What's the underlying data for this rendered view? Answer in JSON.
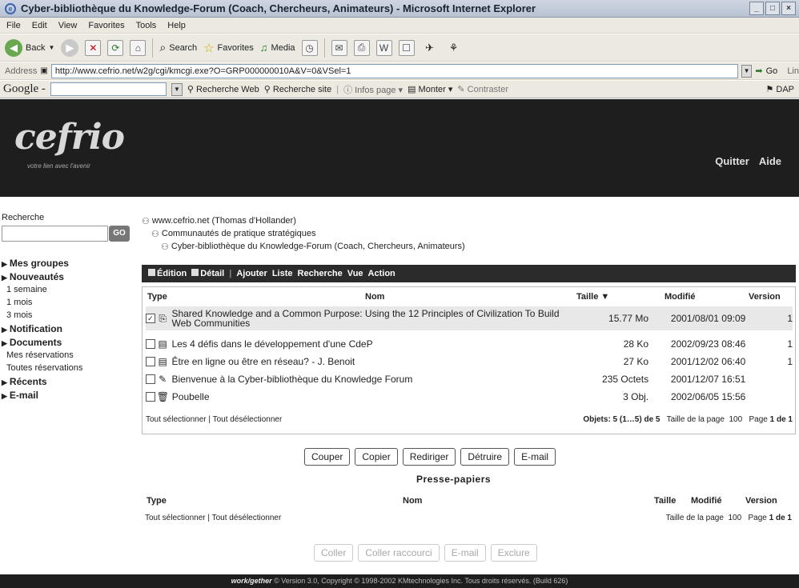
{
  "window": {
    "title": "Cyber-bibliothèque du Knowledge-Forum (Coach, Chercheurs, Animateurs) - Microsoft Internet Explorer",
    "controls": [
      "_",
      "□",
      "×"
    ]
  },
  "menu": [
    "File",
    "Edit",
    "View",
    "Favorites",
    "Tools",
    "Help"
  ],
  "toolbar": {
    "back": "Back",
    "search": "Search",
    "favorites": "Favorites",
    "media": "Media"
  },
  "address": {
    "label": "Address",
    "url": "http://www.cefrio.net/w2g/cgi/kmcgi.exe?O=GRP000000010A&V=0&VSel=1",
    "go": "Go",
    "links": "Lin"
  },
  "google": {
    "logo": "Google -",
    "web_search": "Recherche Web",
    "site_search": "Recherche site",
    "page_info": "Infos page",
    "up": "Monter",
    "contrast": "Contraster",
    "dap": "DAP"
  },
  "header": {
    "logo": "cefrio",
    "tagline": "votre lien avec l'avenir",
    "quit": "Quitter",
    "help": "Aide"
  },
  "sidebar": {
    "search_label": "Recherche",
    "go_label": "GO",
    "items": [
      {
        "label": "Mes groupes",
        "type": "section"
      },
      {
        "label": "Nouveautés",
        "type": "section"
      },
      {
        "label": "1 semaine",
        "type": "sub"
      },
      {
        "label": "1 mois",
        "type": "sub"
      },
      {
        "label": "3 mois",
        "type": "sub"
      },
      {
        "label": "Notification",
        "type": "section"
      },
      {
        "label": "Documents",
        "type": "section"
      },
      {
        "label": "Mes réservations",
        "type": "sub"
      },
      {
        "label": "Toutes réservations",
        "type": "sub"
      },
      {
        "label": "Récents",
        "type": "section"
      },
      {
        "label": "E-mail",
        "type": "section"
      }
    ]
  },
  "breadcrumbs": [
    "www.cefrio.net (Thomas d'Hollander)",
    "Communautés de pratique stratégiques",
    "Cyber-bibliothèque du Knowledge-Forum (Coach, Chercheurs, Animateurs)"
  ],
  "actionbar": {
    "edit": "Édition",
    "detail": "Détail",
    "add": "Ajouter",
    "list": "Liste",
    "search": "Recherche",
    "view": "Vue",
    "action": "Action"
  },
  "filelist": {
    "columns": {
      "type": "Type",
      "name": "Nom",
      "size": "Taille ▼",
      "modified": "Modifié",
      "version": "Version"
    },
    "rows": [
      {
        "checked": "✓",
        "icon": "web",
        "name": "Shared Knowledge and a Common Purpose: Using the 12 Principles of Civilization To Build Web Communities",
        "size": "15.77 Mo",
        "modified": "2001/08/01 09:09",
        "version": "1"
      },
      {
        "checked": "",
        "icon": "doc",
        "name": "Les 4 défis dans le développement d'une CdeP",
        "size": "28 Ko",
        "modified": "2002/09/23 08:46",
        "version": "1"
      },
      {
        "checked": "",
        "icon": "doc",
        "name": "Être en ligne ou être en réseau? - J. Benoit",
        "size": "27 Ko",
        "modified": "2001/12/02 06:40",
        "version": "1"
      },
      {
        "checked": "",
        "icon": "note",
        "name": "Bienvenue à la Cyber-bibliothèque du Knowledge Forum",
        "size": "235 Octets",
        "modified": "2001/12/07 16:51",
        "version": ""
      },
      {
        "checked": "",
        "icon": "trash",
        "name": "Poubelle",
        "size": "3 Obj.",
        "modified": "2002/06/05 15:56",
        "version": ""
      }
    ],
    "select_all": "Tout sélectionner",
    "deselect_all": "Tout désélectionner",
    "objects": "Objets: 5 (1…5) de 5",
    "page_size_label": "Taille de la page",
    "page_size": "100",
    "page_label": "Page",
    "page_info": "1 de 1"
  },
  "buttons": [
    "Couper",
    "Copier",
    "Rediriger",
    "Détruire",
    "E-mail"
  ],
  "clipboard": {
    "title": "Presse-papiers",
    "columns": {
      "type": "Type",
      "name": "Nom",
      "size": "Taille",
      "modified": "Modifié",
      "version": "Version"
    },
    "select_all": "Tout sélectionner",
    "deselect_all": "Tout désélectionner",
    "page_size_label": "Taille de la page",
    "page_size": "100",
    "page_label": "Page",
    "page_info": "1 de 1",
    "buttons": [
      "Coller",
      "Coller raccourci",
      "E-mail",
      "Exclure"
    ]
  },
  "footer": {
    "brand": "work/gether",
    "text": "© Version 3.0, Copyright © 1998-2002 KMtechnologies Inc. Tous droits réservés. (Build 626)"
  }
}
